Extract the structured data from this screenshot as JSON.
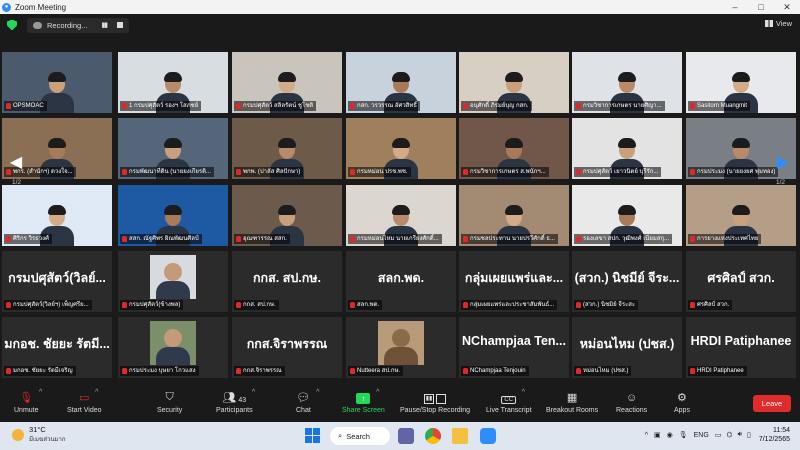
{
  "window": {
    "app_title": "Zoom Meeting",
    "minimize": "–",
    "maximize": "□",
    "close": "✕"
  },
  "meeting_bar": {
    "recording_label": "Recording...",
    "view_label": "View"
  },
  "gallery": {
    "page_left": "1/2",
    "page_right": "1/2",
    "tiles": [
      {
        "name": "OPSMOAC",
        "big": ""
      },
      {
        "name": "1 กรมปศุสัตว์ รองฯ โสภชย์",
        "big": ""
      },
      {
        "name": "กรมปศุสัตว์ สลิลรัตน์ ชูโชติ",
        "big": ""
      },
      {
        "name": "กสก. วรวรรณ อัศวสิทธิ์",
        "big": ""
      },
      {
        "name": "อนุศักดิ์ ภิรมย์บุญ กสก.",
        "big": ""
      },
      {
        "name": "กรมวิชาการเกษตร นายศิญา...",
        "big": ""
      },
      {
        "name": "Sasitorn Muangmit",
        "big": ""
      },
      {
        "name": "พกร. (สำนักฯ) ดวงใจ...",
        "big": ""
      },
      {
        "name": "กรมพัฒนาที่ดิน (นายยงเกียรติ...",
        "big": ""
      },
      {
        "name": "พกพ. (ปาลัส ศิลปักษา)",
        "big": ""
      },
      {
        "name": "กรมหม่อน ปรช.พช.",
        "big": ""
      },
      {
        "name": "กรมวิชาการเกษตร ส.พนักฯ...",
        "big": ""
      },
      {
        "name": "กรมปศุสัตว์ เยาวนิตย์ บุรีรัก...",
        "big": ""
      },
      {
        "name": "กรมประมง (นายยงยศ พุ่มทอง)",
        "big": ""
      },
      {
        "name": "ศิริกร   วิรธวงศ์",
        "big": ""
      },
      {
        "name": "สสก. ณัฐศิพร ผิณพัฒนศิลป์",
        "big": ""
      },
      {
        "name": "อุณฑารรณ สสก.",
        "big": ""
      },
      {
        "name": "กรมหม่อนไหม นายเกรียงศักดิ์...",
        "big": ""
      },
      {
        "name": "กรมชลประทาน นายปรวีศักดิ์ ธ...",
        "big": ""
      },
      {
        "name": "รองเลขา สปก. วุฒิพงศ์ เนียมสกุ...",
        "big": ""
      },
      {
        "name": "การยางแห่งประเทศไทย",
        "big": ""
      },
      {
        "name": "กรมปศุสัตว์(วิลย์ฯ) เพ็ญศรีย...",
        "big": "กรมปศุสัตว์(วิลย์..."
      },
      {
        "name": "กรมปศุสัตว์(ข้างพล)",
        "big": ""
      },
      {
        "name": "กกส. สป.กษ.",
        "big": "กกส. สป.กษ."
      },
      {
        "name": "สลก.พด.",
        "big": "สลก.พด."
      },
      {
        "name": "กลุ่มเผยแพร่และประชาสัมพันธ์...",
        "big": "กลุ่มเผยแพร่และ..."
      },
      {
        "name": "(สวก.) นิชมิย์ จีระสะ",
        "big": "(สวก.) นิชมีย์ จีระ..."
      },
      {
        "name": "ศรศิลป์ สวก.",
        "big": "ศรศิลป์ สวก."
      },
      {
        "name": "มกอช. ชัยยะ รัตมีเจริญ",
        "big": "มกอช. ชัยยะ รัตมี..."
      },
      {
        "name": "กรมประมง บุษยา โกวแสง",
        "big": ""
      },
      {
        "name": "กกส.จิราพรรณ",
        "big": "กกส.จิราพรรณ"
      },
      {
        "name": "Nutteera สป.กษ.",
        "big": ""
      },
      {
        "name": "NChampjaa Tenjouin",
        "big": "NChampjaa  Ten..."
      },
      {
        "name": "หม่อนไหม (ปชส.)",
        "big": "หม่อนไหม (ปชส.)"
      },
      {
        "name": "HRDI Patiphanee",
        "big": "HRDI Patiphanee"
      }
    ]
  },
  "toolbar": {
    "unmute": "Unmute",
    "start_video": "Start Video",
    "security": "Security",
    "participants": "Participants",
    "participants_count": "43",
    "chat": "Chat",
    "share_screen": "Share Screen",
    "pause_stop": "Pause/Stop Recording",
    "live_transcript": "Live Transcript",
    "breakout": "Breakout Rooms",
    "reactions": "Reactions",
    "apps": "Apps",
    "leave": "Leave",
    "cc": "CC"
  },
  "taskbar": {
    "temperature": "31°C",
    "weather_text": "มีเมฆส่วนมาก",
    "search": "Search",
    "lang": "ENG",
    "time": "11:54",
    "date": "7/12/2565"
  },
  "colors": {
    "share_green": "#23d959",
    "leave_red": "#e02b2b",
    "active_outline": "#cfe03a",
    "mic_red": "#e02828"
  }
}
